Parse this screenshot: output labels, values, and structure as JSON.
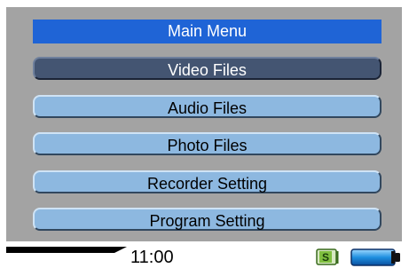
{
  "menu": {
    "title": "Main Menu",
    "items": [
      {
        "label": "Video Files",
        "selected": true
      },
      {
        "label": "Audio Files",
        "selected": false
      },
      {
        "label": "Photo Files",
        "selected": false
      },
      {
        "label": "Recorder Setting",
        "selected": false
      },
      {
        "label": "Program Setting",
        "selected": false
      }
    ]
  },
  "status": {
    "time": "11:00",
    "storage_icon": "sd-card-icon",
    "storage_letter": "S",
    "battery_icon": "battery-icon"
  },
  "colors": {
    "title_bar": "#1f64d6",
    "menu_item": "#8db8e0",
    "menu_item_selected": "#445572",
    "screen_background": "#a3a3a3"
  }
}
